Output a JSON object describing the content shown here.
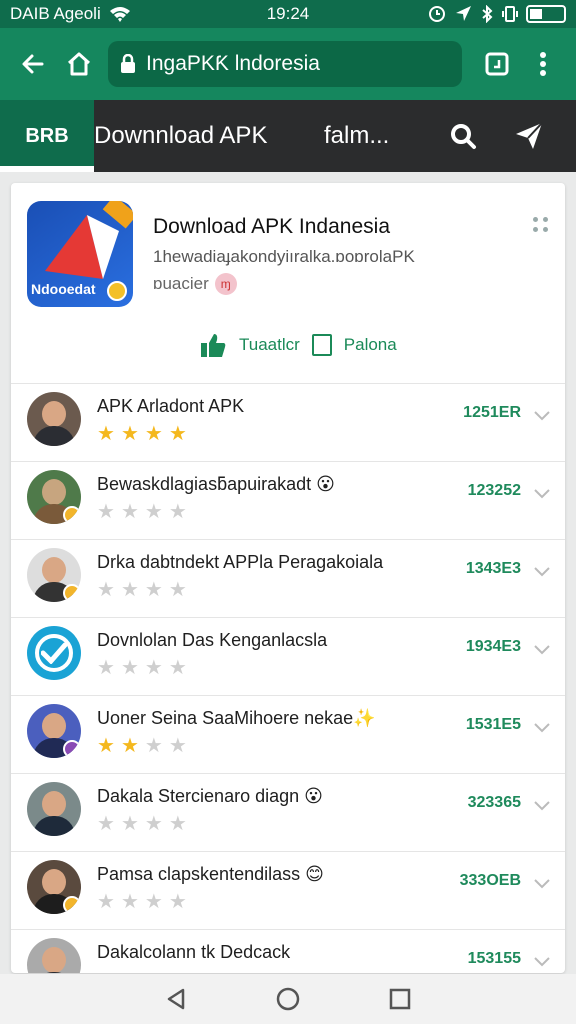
{
  "status_bar": {
    "carrier": "DAIB Ageoli",
    "time": "19:24",
    "icons": [
      "wifi-icon",
      "alarm-icon",
      "location-icon",
      "bluetooth-icon",
      "vibrate-icon",
      "battery-icon"
    ]
  },
  "browser": {
    "url_text": "IngaPKƘ lndoresia",
    "icons": [
      "back-arrow-icon",
      "home-icon",
      "lock-icon",
      "tab-switcher-icon",
      "more-vert-icon"
    ]
  },
  "site_header": {
    "logo_text": "BRB",
    "title": "Downnload APK",
    "link": "falm...",
    "icons": [
      "search-icon",
      "send-icon"
    ]
  },
  "app": {
    "icon_label": "Ndooedat",
    "title": "Download APK Indanesia",
    "subtitle": "1hewadiaɟakondyiıralka.ɒoɒrolaPK",
    "subtitle2": "ɒuacier",
    "pill_text": "ɱ",
    "action_like": "Tuaatlcr",
    "action_other": "Palona"
  },
  "list": [
    {
      "title": "APK Arladont APK",
      "count": "1251ER",
      "stars": 4
    },
    {
      "title": "Bewaskdlagiasƃapuirakadt 😮",
      "count": "123252",
      "stars": 0
    },
    {
      "title": "Drka dabtndekt APPla Peragakoiala",
      "count": "1343E3",
      "stars": 0
    },
    {
      "title": "Dovnlolan Das Kenganlacsla",
      "count": "1934E3",
      "stars": 0
    },
    {
      "title": "Uoner Seina SaaMihoere nekae✨",
      "count": "1531E5",
      "stars": 2
    },
    {
      "title": "Dakala Stercienaro diagn 😮",
      "count": "323365",
      "stars": 0
    },
    {
      "title": "Pamsa clapskentendilass 😊",
      "count": "333OEB",
      "stars": 0
    },
    {
      "title": "Dakalcolann tk Dedcack",
      "count": "153155",
      "stars": 0
    }
  ],
  "colors": {
    "status_bar": "#0f6c4c",
    "browser_bar": "#15875e",
    "header": "#2b2c2d",
    "accent_green": "#1f8a5c",
    "star_on": "#f4b81e"
  }
}
